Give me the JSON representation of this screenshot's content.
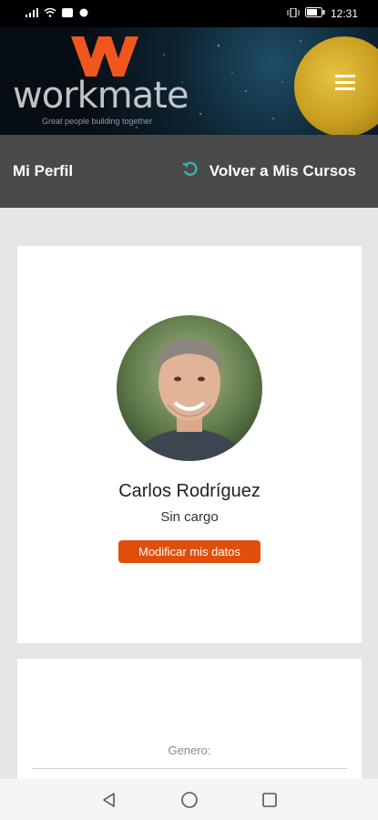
{
  "statusbar": {
    "time": "12:31"
  },
  "brand": {
    "name": "workmate",
    "tagline": "Great people building together"
  },
  "header": {
    "title": "Mi Perfil",
    "back_label": "Volver a Mis Cursos"
  },
  "profile": {
    "name": "Carlos Rodríguez",
    "role": "Sin cargo",
    "edit_label": "Modificar mis datos"
  },
  "details": {
    "gender_label": "Genero:"
  },
  "colors": {
    "accent": "#e04e0c",
    "navbar": "#4a4a4a",
    "back_icon": "#35b8a6"
  }
}
